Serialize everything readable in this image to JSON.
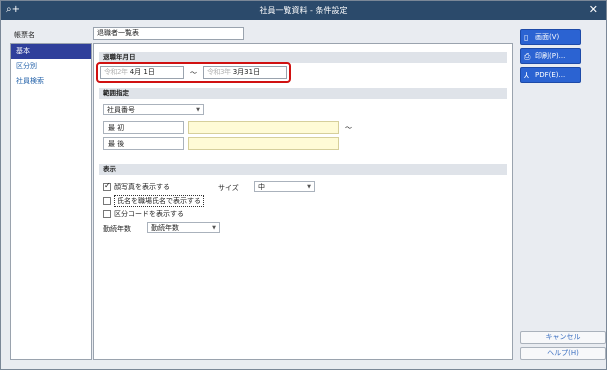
{
  "window": {
    "title": "社員一覧資料 - 条件設定",
    "app_icon": "search-plus-icon",
    "close_icon": "close-icon"
  },
  "form_name": {
    "label": "帳票名",
    "value": "退職者一覧表"
  },
  "sidebar": {
    "items": [
      {
        "label": "基本",
        "active": true
      },
      {
        "label": "区分別",
        "active": false
      },
      {
        "label": "社員検索",
        "active": false
      }
    ]
  },
  "retire_date": {
    "header": "退職年月日",
    "from_era": "令和2年",
    "from_md": "4月  1日",
    "tilde": "～",
    "to_era": "令和3年",
    "to_md": "3月31日"
  },
  "range": {
    "header": "範囲指定",
    "select_value": "社員番号",
    "first_label": "最 初",
    "last_label": "最 後",
    "tilde": "～"
  },
  "display": {
    "header": "表示",
    "show_photo": "顔写真を表示する",
    "show_name": "氏名を職場氏名で表示する",
    "show_category": "区分コードを表示する",
    "size_label": "サイズ",
    "size_value": "中",
    "years_label": "勤続年数",
    "years_value": "勤続年数"
  },
  "buttons": {
    "screen": "画面(V)",
    "print": "印刷(P)...",
    "pdf": "PDF(E)...",
    "cancel": "キャンセル",
    "help": "ヘルプ(H)"
  },
  "colors": {
    "titlebar": "#2b4a6b",
    "accent": "#2b63d2",
    "highlight": "#d01111",
    "active_item": "#2f3f9b"
  }
}
